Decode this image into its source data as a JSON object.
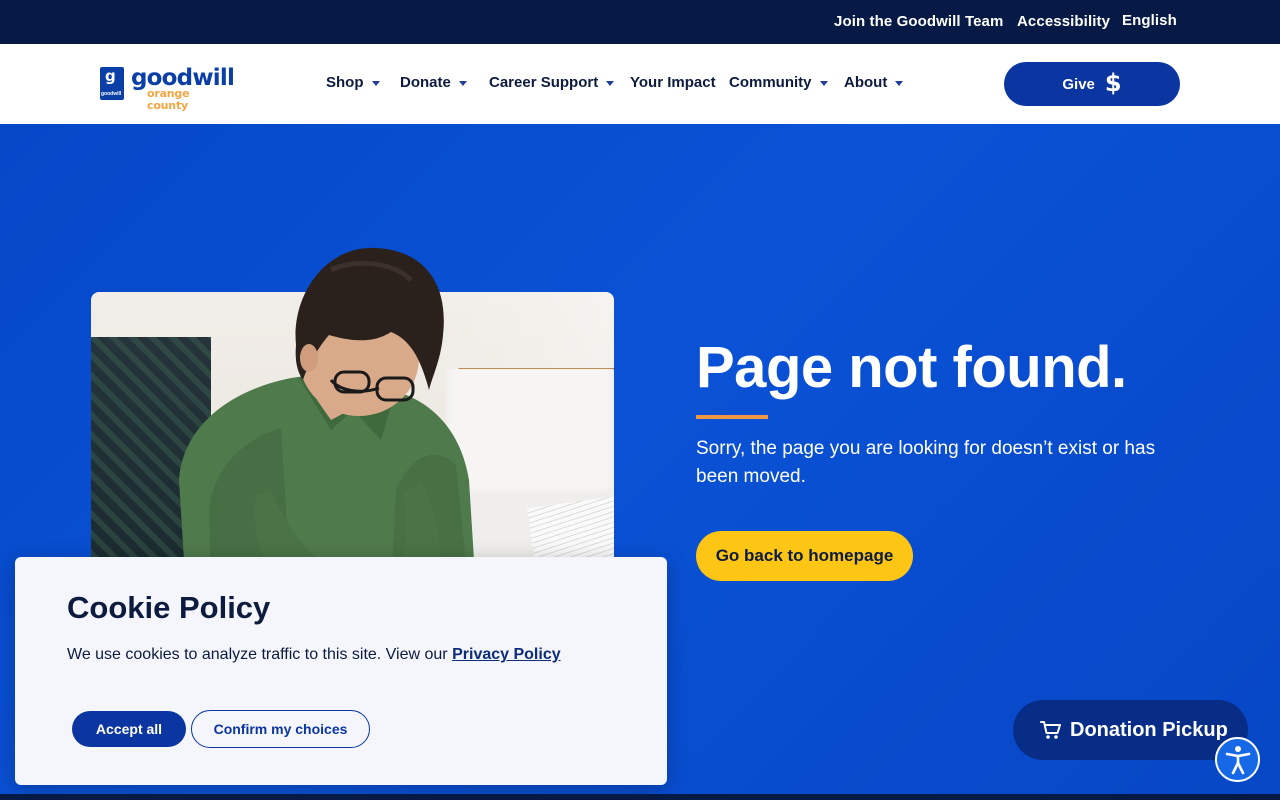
{
  "topbar": {
    "join_label": "Join the Goodwill Team",
    "accessibility_label": "Accessibility",
    "language_label": "English"
  },
  "logo": {
    "mark_letter": "g",
    "mark_small_text": "goodwill",
    "wordmark": "goodwill",
    "subtext": "orange county"
  },
  "nav": {
    "items": [
      {
        "label": "Shop",
        "has_dropdown": true
      },
      {
        "label": "Donate",
        "has_dropdown": true
      },
      {
        "label": "Career Support",
        "has_dropdown": true
      },
      {
        "label": "Your Impact",
        "has_dropdown": false
      },
      {
        "label": "Community",
        "has_dropdown": true
      },
      {
        "label": "About",
        "has_dropdown": true
      }
    ]
  },
  "give_button": {
    "label": "Give",
    "icon": "dollar-icon",
    "symbol": "$"
  },
  "hero": {
    "title": "Page not found.",
    "message": "Sorry, the page you are looking for doesn’t exist or has been moved.",
    "button_label": "Go back to homepage"
  },
  "cookie": {
    "title": "Cookie Policy",
    "text": "We use cookies to analyze traffic to this site. View our",
    "link_label": "Privacy Policy",
    "accept_label": "Accept all",
    "confirm_label": "Confirm my choices"
  },
  "pickup": {
    "label": "Donation Pickup",
    "icon": "cart-icon"
  },
  "accessibility_widget": {
    "icon": "accessibility-person-icon"
  },
  "colors": {
    "topbar": "#061a45",
    "hero_blue": "#0b49c9",
    "brand_blue": "#0b35a0",
    "accent_orange": "#f29845",
    "cta_yellow": "#fdc514",
    "pickup_navy": "#072d86"
  }
}
